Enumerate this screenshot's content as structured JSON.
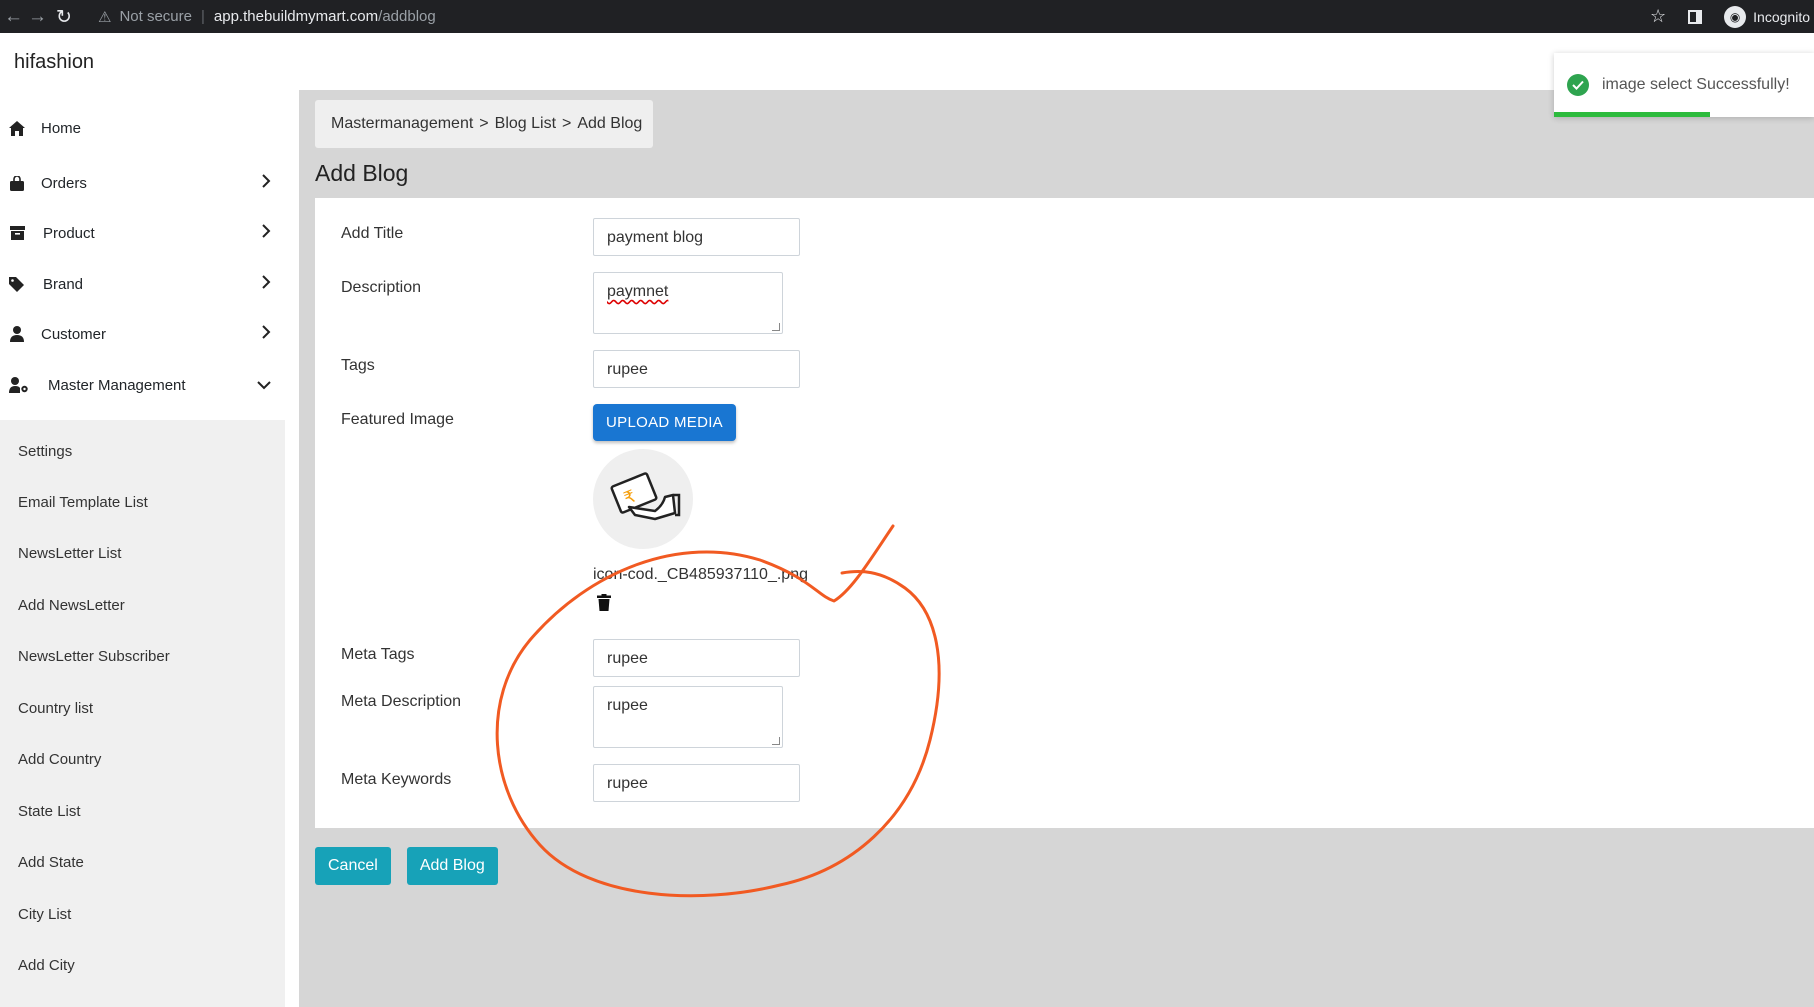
{
  "browser": {
    "security": "Not secure",
    "url_host": "app.thebuildmymart.com",
    "url_path": "/addblog",
    "profile": "Incognito"
  },
  "app": {
    "brand": "hifashion"
  },
  "sidebar": {
    "items": [
      {
        "label": "Home",
        "icon": "home-icon",
        "has_chevron": false
      },
      {
        "label": "Orders",
        "icon": "shopping-bag-icon",
        "has_chevron": true
      },
      {
        "label": "Product",
        "icon": "archive-icon",
        "has_chevron": true
      },
      {
        "label": "Brand",
        "icon": "tags-icon",
        "has_chevron": true
      },
      {
        "label": "Customer",
        "icon": "user-icon",
        "has_chevron": true
      },
      {
        "label": "Master Management",
        "icon": "user-cog-icon",
        "has_chevron": true,
        "expanded": true
      }
    ],
    "submenu": [
      "Settings",
      "Email Template List",
      "NewsLetter List",
      "Add NewsLetter",
      "NewsLetter Subscriber",
      "Country list",
      "Add Country",
      "State List",
      "Add State",
      "City List",
      "Add City"
    ]
  },
  "breadcrumb": [
    "Mastermanagement",
    "Blog List",
    "Add Blog"
  ],
  "breadcrumb_separator": ">",
  "page_title": "Add Blog",
  "form": {
    "title_label": "Add Title",
    "title_value": "payment blog",
    "description_label": "Description",
    "description_value": "paymnet",
    "tags_label": "Tags",
    "tags_value": "rupee",
    "featured_label": "Featured Image",
    "upload_label": "UPLOAD MEDIA",
    "image_filename": "icon-cod._CB485937110_.png",
    "meta_tags_label": "Meta Tags",
    "meta_tags_value": "rupee",
    "meta_desc_label": "Meta Description",
    "meta_desc_value": "rupee",
    "meta_keywords_label": "Meta Keywords",
    "meta_keywords_value": "rupee"
  },
  "actions": {
    "cancel": "Cancel",
    "submit": "Add Blog"
  },
  "toast": {
    "message": "image select Successfully!",
    "progress": 0.6
  },
  "colors": {
    "accent": "#17a2b8",
    "upload": "#1976d2",
    "success": "#2dbb3d",
    "annotation": "#f15a22"
  }
}
